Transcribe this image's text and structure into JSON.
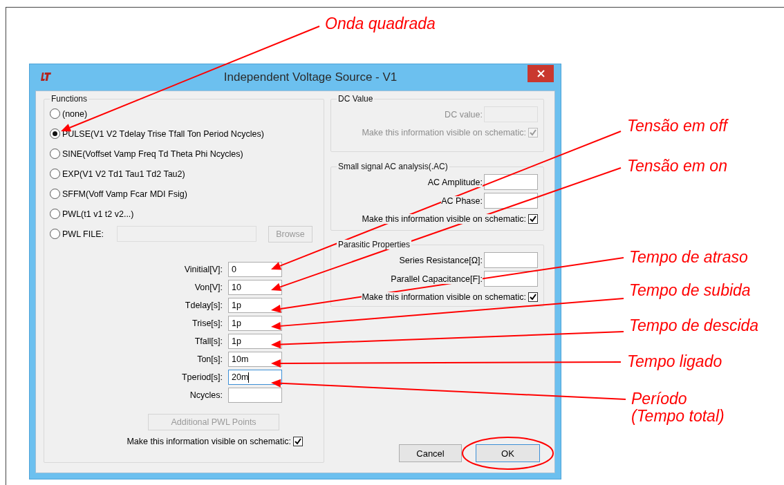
{
  "window": {
    "title": "Independent Voltage Source - V1"
  },
  "functions": {
    "title": "Functions",
    "options": [
      {
        "label": "(none)",
        "selected": false
      },
      {
        "label": "PULSE(V1 V2 Tdelay Trise Tfall Ton Period Ncycles)",
        "selected": true
      },
      {
        "label": "SINE(Voffset Vamp Freq Td Theta Phi Ncycles)",
        "selected": false
      },
      {
        "label": "EXP(V1 V2 Td1 Tau1 Td2 Tau2)",
        "selected": false
      },
      {
        "label": "SFFM(Voff Vamp Fcar MDI Fsig)",
        "selected": false
      },
      {
        "label": "PWL(t1 v1 t2 v2...)",
        "selected": false
      },
      {
        "label": "PWL FILE:",
        "selected": false,
        "kind": "file"
      }
    ],
    "browse_button": {
      "label": "Browse",
      "disabled": true
    },
    "parameters": [
      {
        "label": "Vinitial[V]:",
        "value": "0",
        "focused": false
      },
      {
        "label": "Von[V]:",
        "value": "10",
        "focused": false
      },
      {
        "label": "Tdelay[s]:",
        "value": "1p",
        "focused": false
      },
      {
        "label": "Trise[s]:",
        "value": "1p",
        "focused": false
      },
      {
        "label": "Tfall[s]:",
        "value": "1p",
        "focused": false
      },
      {
        "label": "Ton[s]:",
        "value": "10m",
        "focused": false
      },
      {
        "label": "Tperiod[s]:",
        "value": "20m",
        "focused": true
      },
      {
        "label": "Ncycles:",
        "focused": false
      }
    ],
    "additional_button": {
      "label": "Additional PWL Points",
      "disabled": true
    },
    "visible": {
      "label": "Make this information visible on schematic:",
      "checked": true,
      "disabled": false
    }
  },
  "dc_value": {
    "title": "DC Value",
    "fields": [
      {
        "label": "DC value:",
        "disabled": true
      }
    ],
    "visible": {
      "label": "Make this information visible on schematic:",
      "checked": true,
      "disabled": true
    }
  },
  "ac_analysis": {
    "title": "Small signal AC analysis(.AC)",
    "fields": [
      {
        "label": "AC Amplitude:",
        "disabled": false
      },
      {
        "label": "AC Phase:",
        "disabled": false
      }
    ],
    "visible": {
      "label": "Make this information visible on schematic:",
      "checked": true,
      "disabled": false
    }
  },
  "parasitic": {
    "title": "Parasitic Properties",
    "fields": [
      {
        "label": "Series Resistance[Ω]:",
        "disabled": false
      },
      {
        "label": "Parallel Capacitance[F]:",
        "disabled": false
      }
    ],
    "visible": {
      "label": "Make this information visible on schematic:",
      "checked": true,
      "disabled": false
    }
  },
  "buttons": [
    {
      "label": "Cancel",
      "default": false,
      "circled": false
    },
    {
      "label": "OK",
      "default": true,
      "circled": true
    }
  ],
  "annotations": [
    {
      "lines": [
        "Onda quadrada"
      ]
    },
    {
      "lines": [
        "Tensão em off"
      ]
    },
    {
      "lines": [
        "Tensão em on"
      ]
    },
    {
      "lines": [
        "Tempo de atraso"
      ]
    },
    {
      "lines": [
        "Tempo de subida"
      ]
    },
    {
      "lines": [
        "Tempo de descida"
      ]
    },
    {
      "lines": [
        "Tempo ligado"
      ]
    },
    {
      "lines": [
        "Período",
        "(Tempo total)"
      ]
    }
  ]
}
